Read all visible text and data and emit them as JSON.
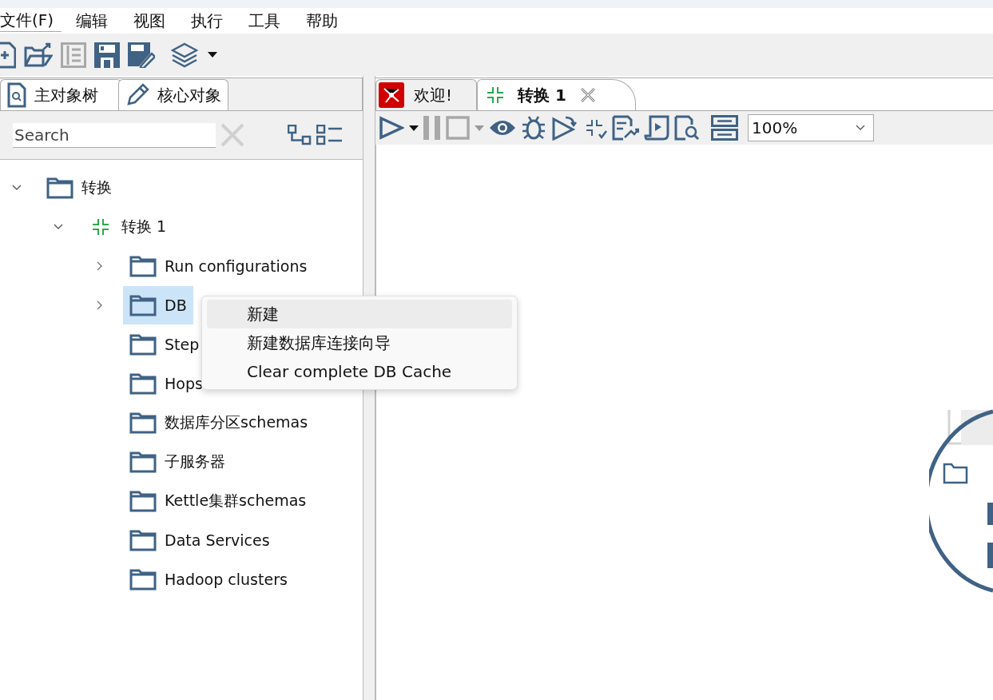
{
  "menu_bar": [
    {
      "label": "文件(F)",
      "selected": true
    },
    {
      "label": "编辑",
      "selected": false
    },
    {
      "label": "视图",
      "selected": false
    },
    {
      "label": "执行",
      "selected": false
    },
    {
      "label": "工具",
      "selected": false
    },
    {
      "label": "帮助",
      "selected": false
    }
  ],
  "left_tabs": [
    {
      "label": "主对象树",
      "selected": true
    },
    {
      "label": "核心对象",
      "selected": false
    }
  ],
  "search": {
    "placeholder": "Search"
  },
  "tree": [
    {
      "label": "转换",
      "kind": "folder",
      "expanded": true,
      "selected": false,
      "children": [
        {
          "label": "转换 1",
          "kind": "transform",
          "expanded": true,
          "selected": false,
          "children": [
            {
              "label": "Run configurations",
              "kind": "folder",
              "expanded": false,
              "selected": false
            },
            {
              "label": "DB",
              "kind": "folder",
              "expanded": false,
              "selected": true
            },
            {
              "label": "Step",
              "kind": "folder",
              "selected": false
            },
            {
              "label": "Hops",
              "kind": "folder",
              "selected": false
            },
            {
              "label": "数据库分区schemas",
              "kind": "folder",
              "selected": false
            },
            {
              "label": "子服务器",
              "kind": "folder",
              "selected": false
            },
            {
              "label": "Kettle集群schemas",
              "kind": "folder",
              "selected": false
            },
            {
              "label": "Data Services",
              "kind": "folder",
              "selected": false
            },
            {
              "label": "Hadoop clusters",
              "kind": "folder",
              "selected": false
            }
          ]
        }
      ]
    }
  ],
  "editor_tabs": [
    {
      "label": "欢迎!",
      "kind": "welcome",
      "selected": false
    },
    {
      "label": "转换 1",
      "kind": "transform",
      "selected": true
    }
  ],
  "zoom": {
    "value": "100%"
  },
  "context_menu": [
    {
      "label": "新建",
      "highlighted": true
    },
    {
      "label": "新建数据库连接向导",
      "highlighted": false
    },
    {
      "label": "Clear complete DB Cache",
      "highlighted": false
    }
  ]
}
